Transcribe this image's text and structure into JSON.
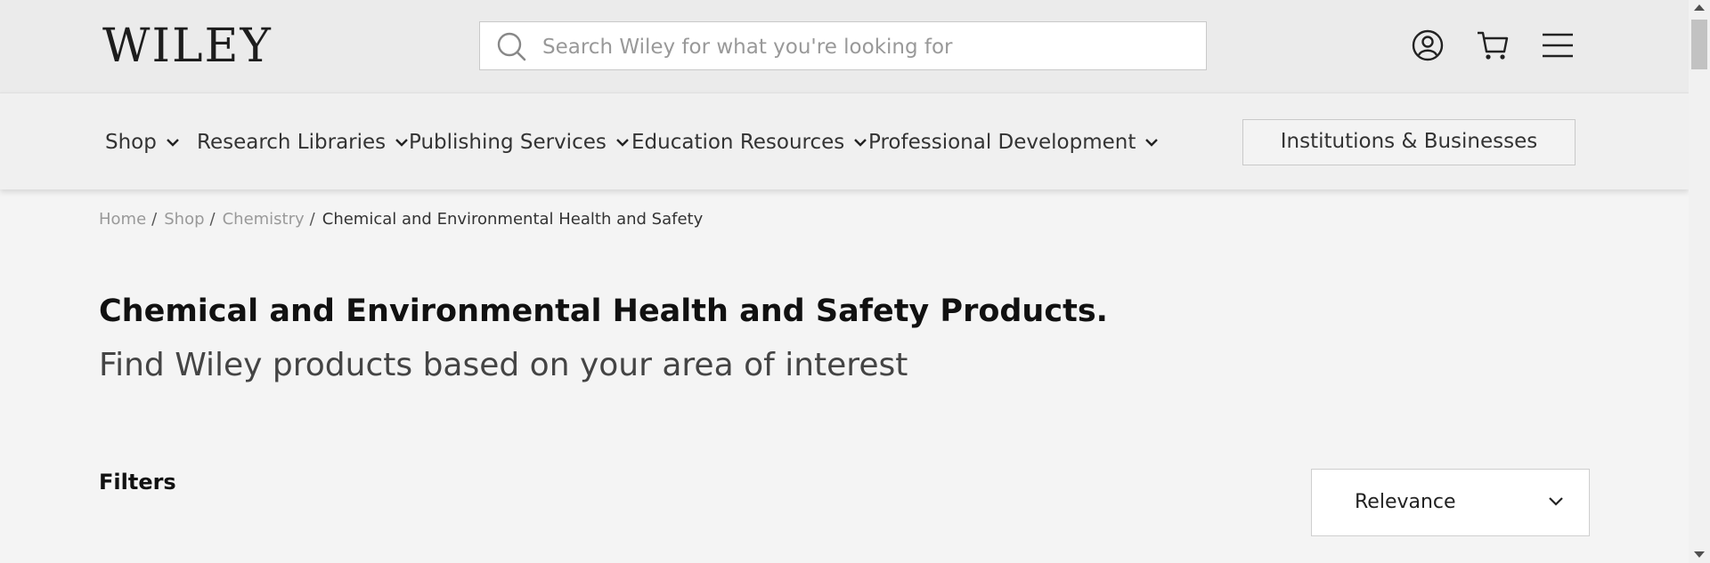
{
  "header": {
    "logo": "WILEY",
    "search_placeholder": "Search Wiley for what you're looking for",
    "icons": [
      "user-icon",
      "cart-icon",
      "hamburger-menu-icon"
    ]
  },
  "nav": {
    "items": [
      {
        "label": "Shop"
      },
      {
        "label": "Research Libraries"
      },
      {
        "label": "Publishing Services"
      },
      {
        "label": "Education Resources"
      },
      {
        "label": "Professional Development"
      }
    ],
    "institutions_button": "Institutions & Businesses"
  },
  "breadcrumb": {
    "items": [
      "Home",
      "Shop",
      "Chemistry"
    ],
    "current": "Chemical and Environmental Health and Safety",
    "separator": "/"
  },
  "main": {
    "title": "Chemical and Environmental Health and Safety Products.",
    "subtitle": "Find Wiley products based on your area of interest",
    "filters_label": "Filters",
    "sort_selected": "Relevance"
  }
}
